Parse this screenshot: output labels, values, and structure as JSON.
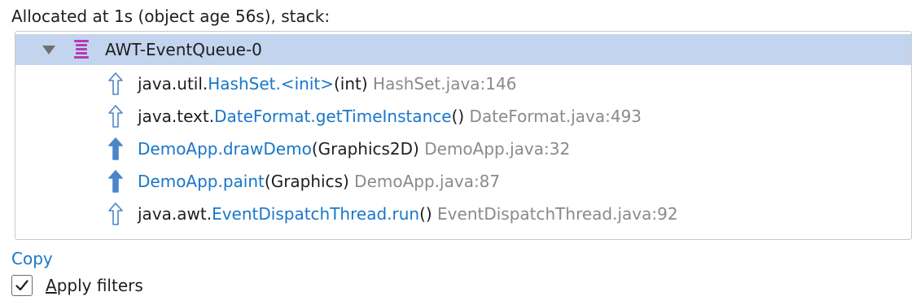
{
  "header": {
    "text": "Allocated at 1s (object age 56s), stack:"
  },
  "tree": {
    "root": {
      "label": "AWT-EventQueue-0",
      "icon": "thread-stack-icon",
      "expanded": true,
      "selected": true
    },
    "frames": [
      {
        "icon": "hollow-up-arrow-icon",
        "package": "java.util.",
        "method": "HashSet.<init>",
        "params": "(int)",
        "location": " HashSet.java:146"
      },
      {
        "icon": "hollow-up-arrow-icon",
        "package": "java.text.",
        "method": "DateFormat.getTimeInstance",
        "params": "()",
        "location": " DateFormat.java:493"
      },
      {
        "icon": "filled-up-arrow-icon",
        "package": "",
        "method": "DemoApp.drawDemo",
        "params": "(Graphics2D)",
        "location": " DemoApp.java:32"
      },
      {
        "icon": "filled-up-arrow-icon",
        "package": "",
        "method": "DemoApp.paint",
        "params": "(Graphics)",
        "location": " DemoApp.java:87"
      },
      {
        "icon": "hollow-up-arrow-icon",
        "package": "java.awt.",
        "method": "EventDispatchThread.run",
        "params": "()",
        "location": " EventDispatchThread.java:92"
      }
    ]
  },
  "actions": {
    "copy_label": "Copy"
  },
  "filters": {
    "checkbox_label_mnemonic": "A",
    "checkbox_label_rest": "pply filters",
    "checked": true
  },
  "colors": {
    "selection": "#c3d4ee",
    "link": "#1a76c9",
    "location": "#8a8a8a",
    "thread_icon": "#b43cb4",
    "arrow": "#4a86c8"
  }
}
